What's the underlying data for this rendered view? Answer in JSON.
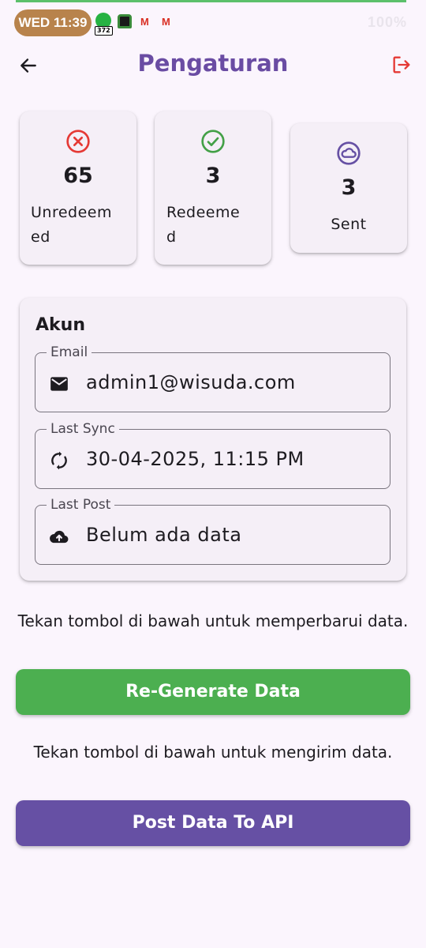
{
  "status_bar": {
    "time": "WED 11:39",
    "whatsapp_badge": "372",
    "right_status": "100%",
    "notification_icons": [
      "whatsapp-icon",
      "bot-icon",
      "gmail-icon",
      "gmail-icon"
    ]
  },
  "header": {
    "title": "Pengaturan",
    "back_icon": "arrow-left-icon",
    "logout_icon": "logout-icon"
  },
  "stats": {
    "unredeemed": {
      "value": "65",
      "label_line1": "Unredeem",
      "label_line2": "ed",
      "icon": "x-circle-icon",
      "color": "#e53935"
    },
    "redeemed": {
      "value": "3",
      "label_line1": "Redeeme",
      "label_line2": "d",
      "icon": "check-circle-icon",
      "color": "#43a047"
    },
    "sent": {
      "value": "3",
      "label": "Sent",
      "icon": "cloud-circle-icon",
      "color": "#6650a4"
    }
  },
  "account": {
    "title": "Akun",
    "email": {
      "label": "Email",
      "value": "admin1@wisuda.com",
      "icon": "mail-icon"
    },
    "last_sync": {
      "label": "Last Sync",
      "value": "30-04-2025, 11:15 PM",
      "icon": "sync-icon"
    },
    "last_post": {
      "label": "Last Post",
      "value": "Belum ada data",
      "icon": "cloud-upload-icon"
    }
  },
  "regenerate": {
    "hint": "Tekan tombol di bawah untuk memperbarui data.",
    "button_label": "Re-Generate Data",
    "color": "#4caf50"
  },
  "post": {
    "hint": "Tekan tombol di bawah untuk mengirim data.",
    "button_label": "Post Data To API",
    "color": "#6650a4"
  },
  "colors": {
    "background": "#fbf5fd",
    "card": "#f5eff7",
    "title": "#6a4ca3",
    "logout": "#e53935"
  }
}
